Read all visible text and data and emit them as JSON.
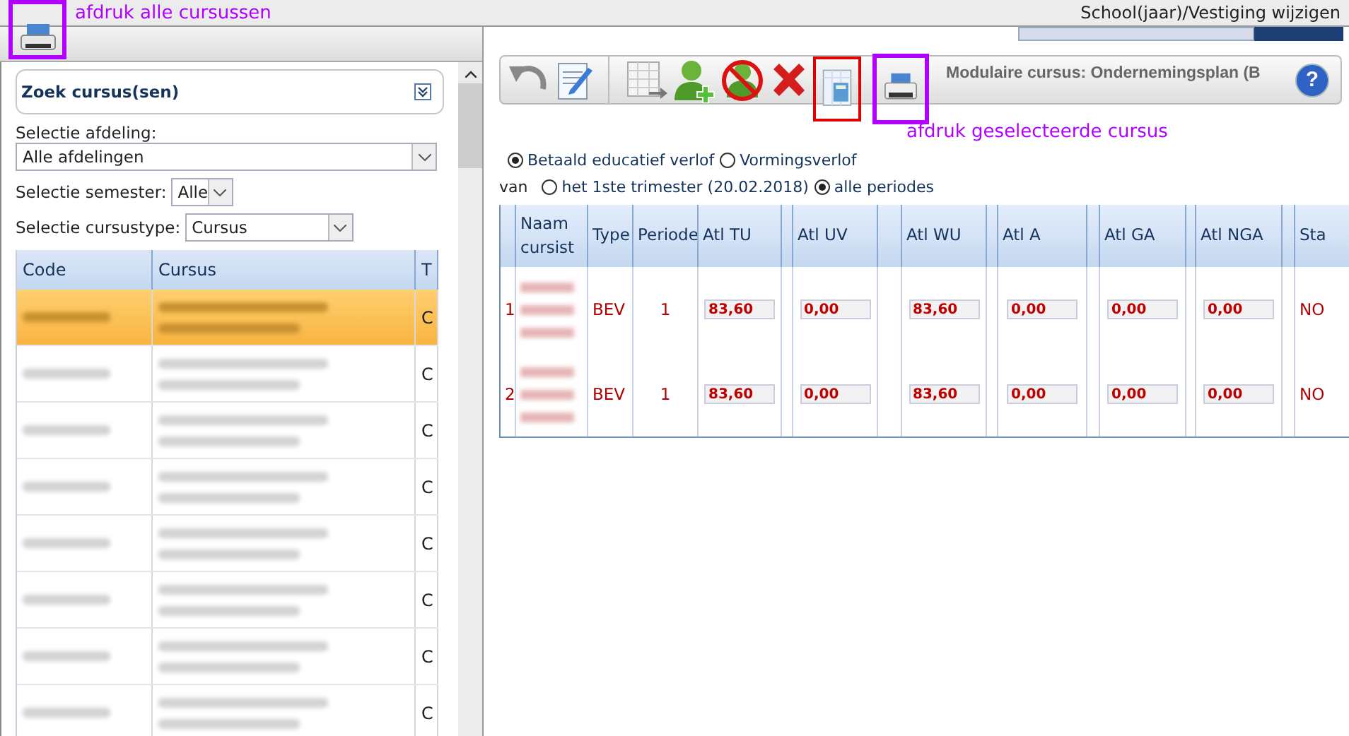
{
  "top_bar": {
    "link": "School(jaar)/Vestiging wijzigen"
  },
  "annotations": [
    {
      "text": "afdruk alle cursussen",
      "color": "#b000ff"
    },
    {
      "text": "afdruk geselecteerde cursus",
      "color": "#b000ff"
    }
  ],
  "search_panel": {
    "title": "Zoek cursus(sen)",
    "afdeling_label": "Selectie afdeling:",
    "afdeling_value": "Alle afdelingen",
    "semester_label": "Selectie semester:",
    "semester_value": "Alle",
    "type_label": "Selectie cursustype:",
    "type_value": "Cursus"
  },
  "course_table": {
    "columns": [
      "Code",
      "Cursus",
      "T"
    ],
    "rows": [
      {
        "selected": true,
        "type": "C"
      },
      {
        "selected": false,
        "type": "C"
      },
      {
        "selected": false,
        "type": "C"
      },
      {
        "selected": false,
        "type": "C"
      },
      {
        "selected": false,
        "type": "C"
      },
      {
        "selected": false,
        "type": "C"
      },
      {
        "selected": false,
        "type": "C"
      },
      {
        "selected": false,
        "type": "C"
      }
    ]
  },
  "toolbar": {
    "title": "Modulaire cursus: Ondernemingsplan (B",
    "help": "?"
  },
  "leave_options": [
    {
      "label": "Betaald educatief verlof",
      "selected": true
    },
    {
      "label": "Vormingsverlof",
      "selected": false
    }
  ],
  "period_prefix": "van",
  "period_options": [
    {
      "label": "het 1ste trimester (20.02.2018)",
      "selected": false
    },
    {
      "label": "alle periodes",
      "selected": true
    }
  ],
  "student_table": {
    "columns": [
      "Naam cursist",
      "Type",
      "Periode",
      "Atl TU",
      "Atl UV",
      "Atl WU",
      "Atl A",
      "Atl GA",
      "Atl NGA",
      "Sta"
    ],
    "rows": [
      {
        "index": "1",
        "type": "BEV",
        "periode": "1",
        "values": [
          "83,60",
          "0,00",
          "83,60",
          "0,00",
          "0,00",
          "0,00"
        ],
        "status": "NO"
      },
      {
        "index": "2",
        "type": "BEV",
        "periode": "1",
        "values": [
          "83,60",
          "0,00",
          "83,60",
          "0,00",
          "0,00",
          "0,00"
        ],
        "status": "NO"
      }
    ]
  }
}
